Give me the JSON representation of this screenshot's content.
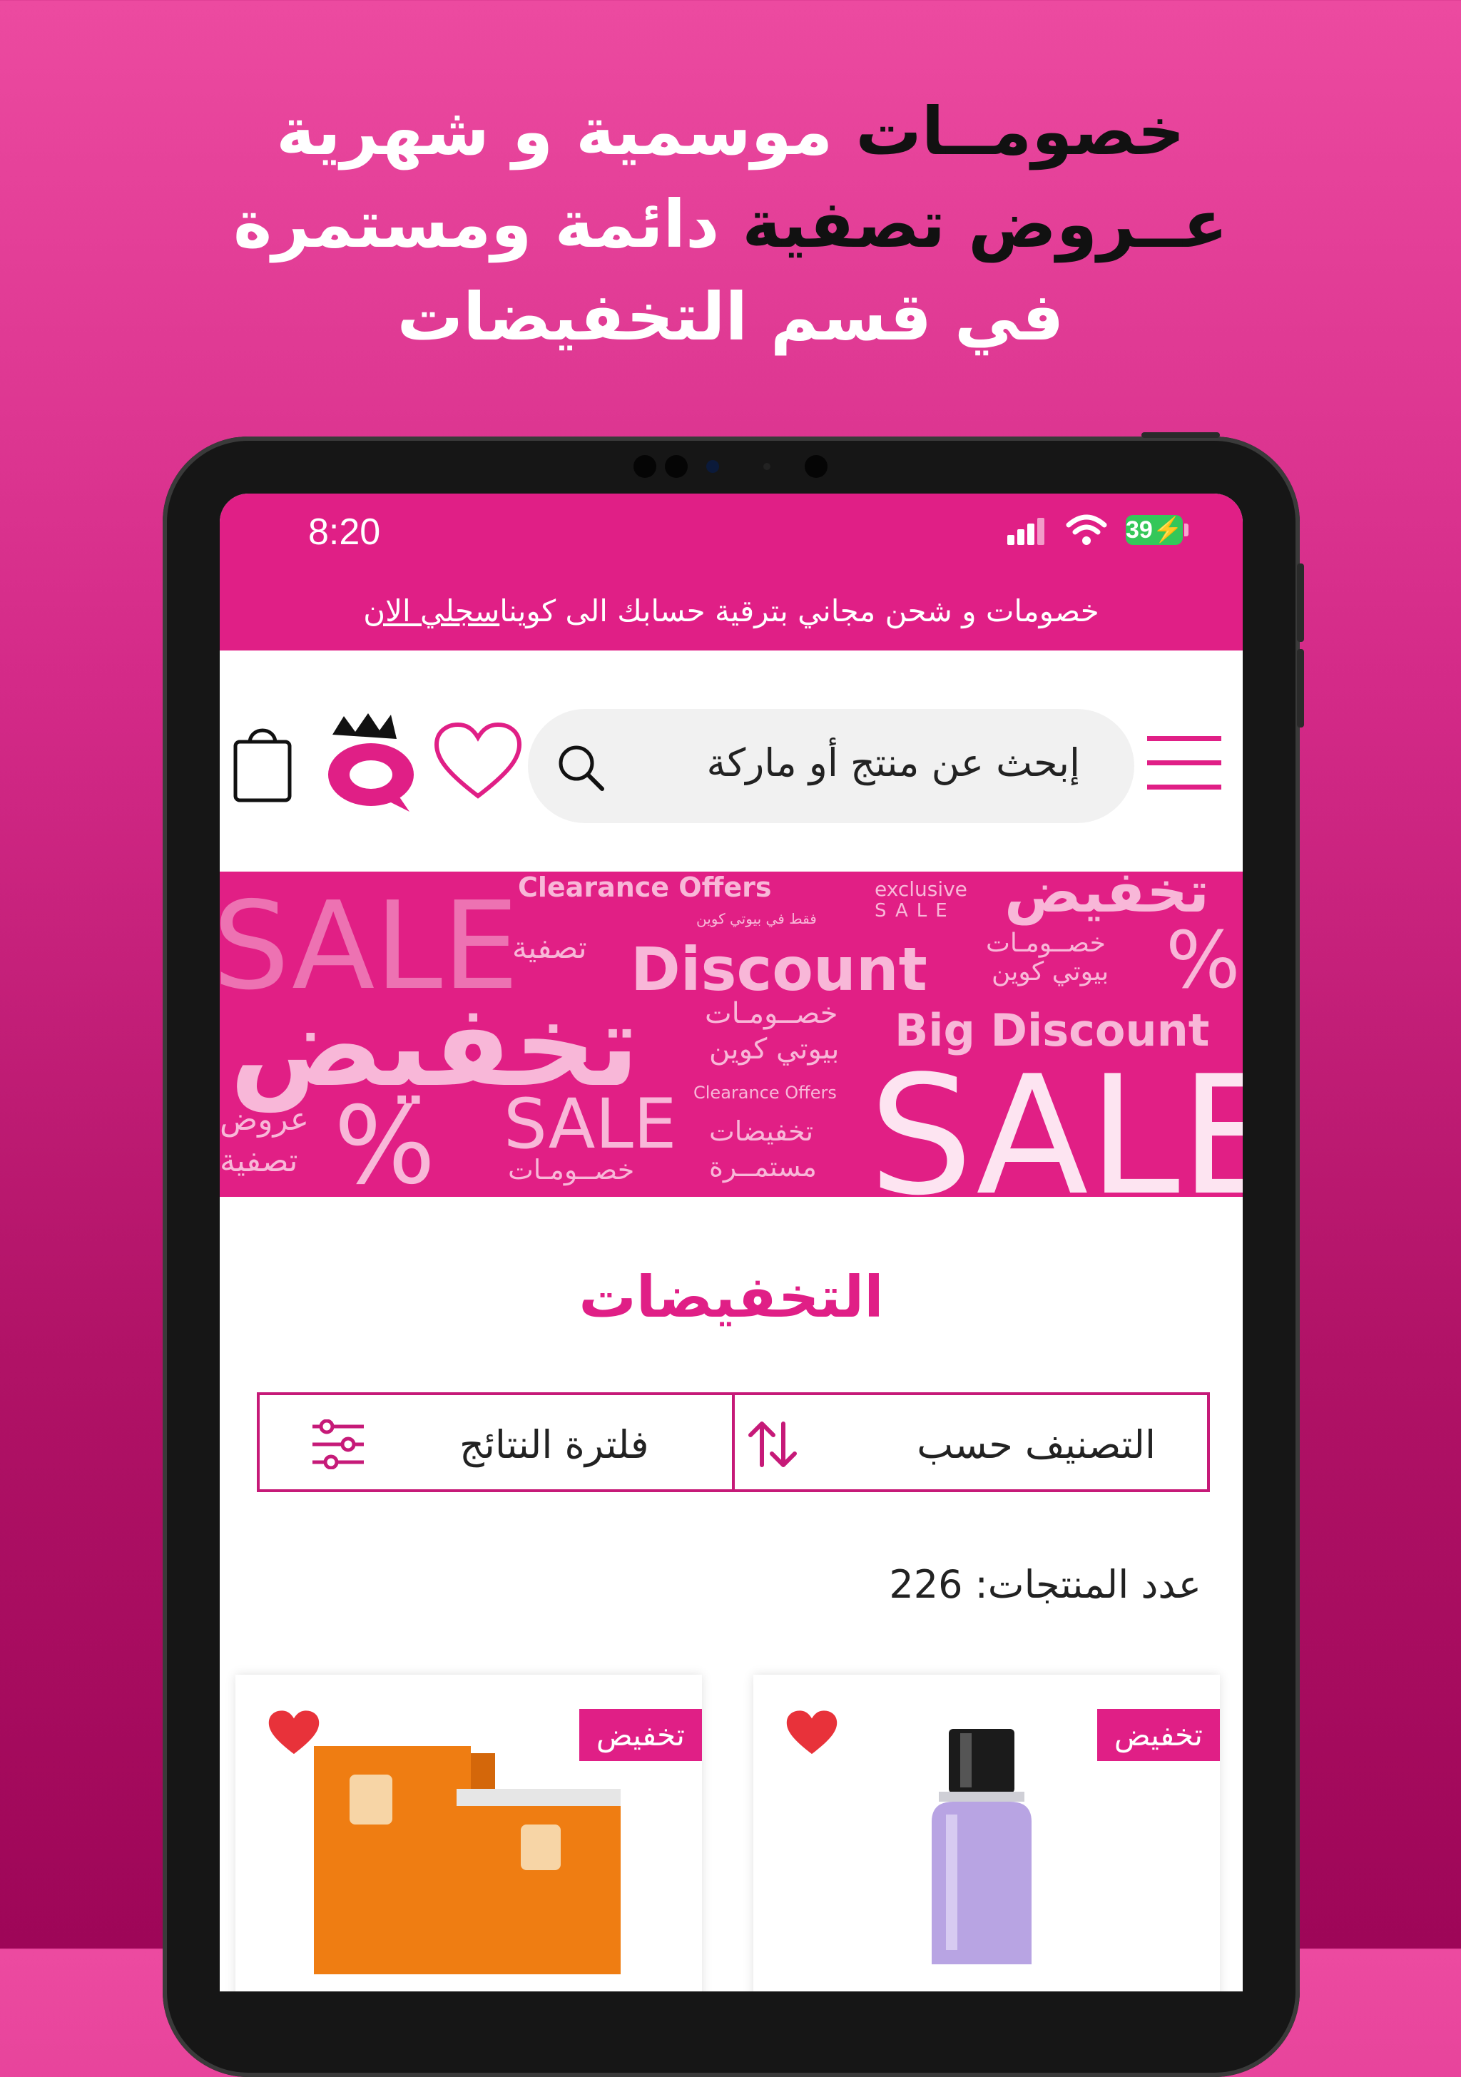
{
  "headline": {
    "line1_a": "خصومــات",
    "line1_b": "موسمية و شهرية",
    "line2_a": "عــروض تصفية",
    "line2_b": "دائمة ومستمرة",
    "line3": "في قسم التخفيضات"
  },
  "status_bar": {
    "time": "8:20",
    "battery": "39"
  },
  "promo": {
    "text": "خصومات و شحن مجاني بترقية حسابك الى كوينا",
    "link": "سجلي الان"
  },
  "search": {
    "placeholder": "إبحث عن منتج أو ماركة"
  },
  "banner": {
    "words": [
      "تخفيض",
      "Clearance Offers",
      "exclusive",
      "SALE",
      "SALE",
      "تصفية",
      "Discount",
      "خصــومـات",
      "بيوتي كوين",
      "فقط في بيوتي كوين",
      "%",
      "تخفيض",
      "خصــومـات",
      "بيوتي كوين",
      "Big Discount",
      "Clearance Offers",
      "عروض",
      "تصفية",
      "%",
      "SALE",
      "خصــومـات",
      "تخفيضات",
      "مستمــرة",
      "SALE"
    ]
  },
  "page": {
    "title": "التخفيضات",
    "sort_label": "التصنيف حسب",
    "filter_label": "فلترة النتائج",
    "count_label": "عدد المنتجات:",
    "count_value": "226"
  },
  "products": [
    {
      "badge": "تخفيض",
      "image": "micellar-bottle"
    },
    {
      "badge": "تخفيض",
      "image": "fiderma-sunfid-50"
    }
  ],
  "colors": {
    "brand": "#e01f86",
    "banner_text": "#f8b7d8",
    "heart": "#e8323a"
  }
}
